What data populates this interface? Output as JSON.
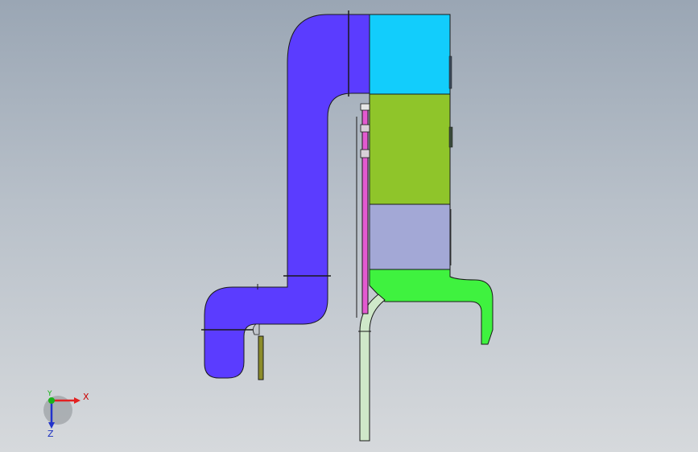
{
  "viewport": {
    "background_top": "#9aa6b4",
    "background_bottom": "#d6d9dc"
  },
  "model": {
    "duct_color": "#5b3cff",
    "unit_top_color": "#12cdfc",
    "unit_mid_color": "#8fc52a",
    "unit_low_color": "#a3a8d6",
    "hopper_color": "#3ff23f",
    "pipe_color": "#e35ad0",
    "drain_pipe_color": "#cfe8c9",
    "outline_color": "#1a1a1a"
  },
  "triad": {
    "x_label": "X",
    "y_label": "Y",
    "z_label": "Z",
    "x_color": "#e32020",
    "y_color": "#19b219",
    "z_color": "#2233cc"
  }
}
